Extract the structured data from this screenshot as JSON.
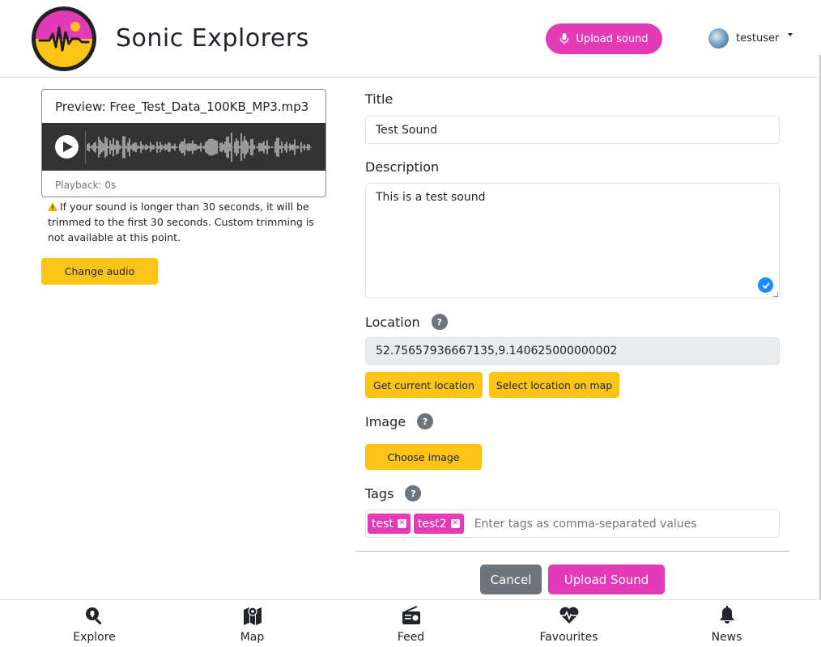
{
  "header": {
    "app_title": "Sonic Explorers",
    "upload_label": "Upload sound",
    "username": "testuser"
  },
  "preview": {
    "title": "Preview: Free_Test_Data_100KB_MP3.mp3",
    "playback": "Playback: 0s",
    "warning": "If your sound is longer than 30 seconds, it will be trimmed to the first 30 seconds. Custom trimming is not available at this point.",
    "change_audio_label": "Change audio"
  },
  "form": {
    "title_label": "Title",
    "title_value": "Test Sound",
    "description_label": "Description",
    "description_value": "This is a test sound",
    "location_label": "Location",
    "location_value": "52.75657936667135,9.140625000000002",
    "get_location_label": "Get current location",
    "select_location_label": "Select location on map",
    "image_label": "Image",
    "choose_image_label": "Choose image",
    "tags_label": "Tags",
    "tags": [
      "test",
      "test2"
    ],
    "tags_placeholder": "Enter tags as comma-separated values",
    "help_glyph": "?",
    "cancel_label": "Cancel",
    "submit_label": "Upload Sound"
  },
  "nav": {
    "items": [
      {
        "label": "Explore",
        "icon": "search-location-icon"
      },
      {
        "label": "Map",
        "icon": "map-icon"
      },
      {
        "label": "Feed",
        "icon": "radio-icon"
      },
      {
        "label": "Favourites",
        "icon": "heartbeat-icon"
      },
      {
        "label": "News",
        "icon": "bell-icon"
      }
    ]
  },
  "colors": {
    "accent": "#e33bb8",
    "yellow": "#fcc419",
    "gray_button": "#6c757d",
    "player_bg": "#333333"
  }
}
